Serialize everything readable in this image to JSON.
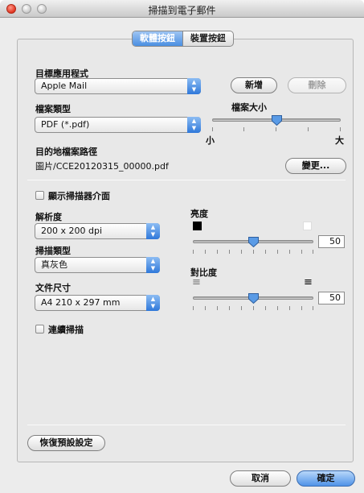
{
  "window": {
    "title": "掃描到電子郵件"
  },
  "tabs": [
    {
      "label": "軟體按鈕",
      "active": true
    },
    {
      "label": "裝置按鈕",
      "active": false
    }
  ],
  "target_app": {
    "label": "目標應用程式",
    "value": "Apple Mail",
    "add_button": "新增",
    "delete_button": "刪除"
  },
  "file_type": {
    "label": "檔案類型",
    "value": "PDF (*.pdf)"
  },
  "file_size": {
    "label": "檔案大小",
    "min_label": "小",
    "max_label": "大",
    "level": 0.5
  },
  "destination": {
    "label": "目的地檔案路徑",
    "path": "圖片/CCE20120315_00000.pdf",
    "change_button": "變更..."
  },
  "show_scanner_ui": {
    "label": "顯示掃描器介面",
    "checked": false
  },
  "resolution": {
    "label": "解析度",
    "value": "200 x 200 dpi"
  },
  "scan_type": {
    "label": "掃描類型",
    "value": "真灰色"
  },
  "document_size": {
    "label": "文件尺寸",
    "value": "A4 210 x 297 mm"
  },
  "brightness": {
    "label": "亮度",
    "value": "50"
  },
  "contrast": {
    "label": "對比度",
    "value": "50"
  },
  "continuous_scan": {
    "label": "連續掃描",
    "checked": false
  },
  "restore_defaults_button": "恢復預設設定",
  "cancel_button": "取消",
  "ok_button": "確定",
  "colors": {
    "accent": "#4a8fe2",
    "close": "#e2331f"
  }
}
